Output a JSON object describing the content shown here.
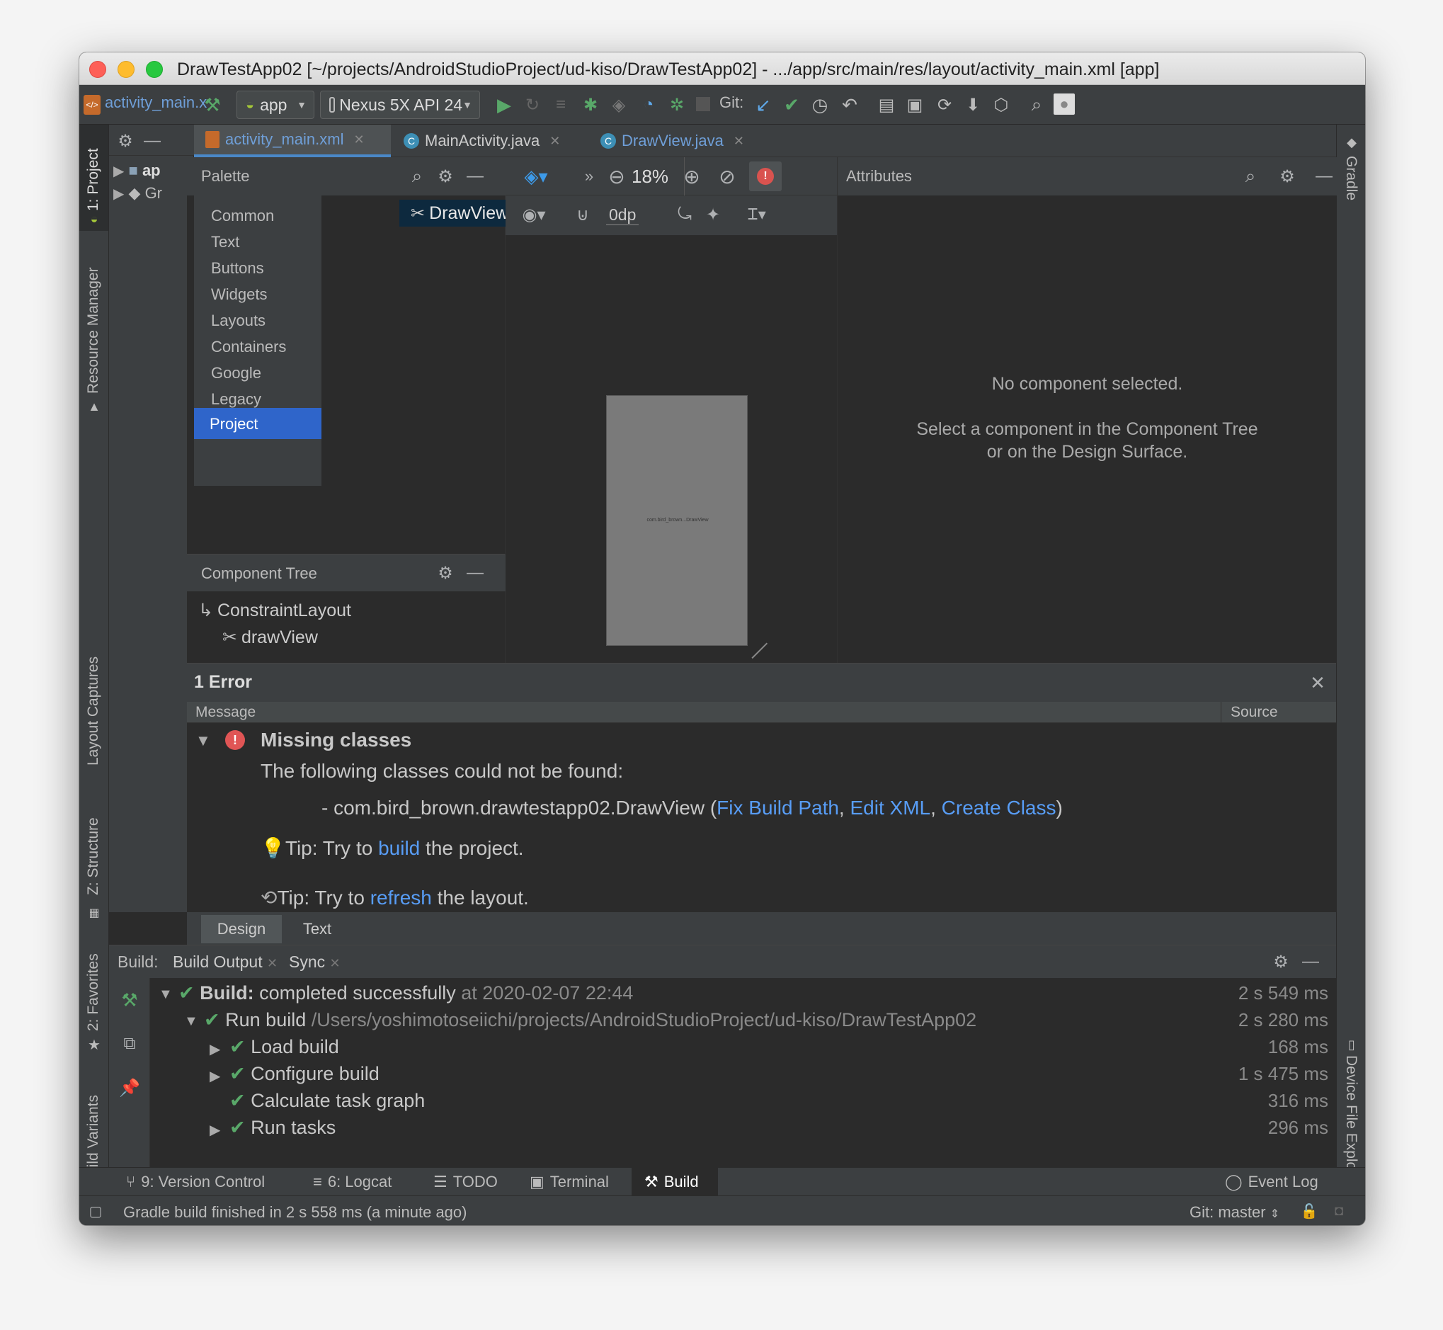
{
  "window": {
    "title": "DrawTestApp02 [~/projects/AndroidStudioProject/ud-kiso/DrawTestApp02] - .../app/src/main/res/layout/activity_main.xml [app]"
  },
  "toolbar": {
    "file_label": "activity_main.x",
    "module": "app",
    "device": "Nexus 5X API 24",
    "git_label": "Git:"
  },
  "left_tool_windows": [
    "1: Project",
    "Resource Manager",
    "Layout Captures",
    "Z: Structure",
    "2: Favorites",
    "Build Variants"
  ],
  "right_tool_windows": [
    "Gradle",
    "Device File Explorer"
  ],
  "project_tree": {
    "items": [
      "ap",
      "Gr"
    ]
  },
  "editor_tabs": [
    {
      "label": "activity_main.xml",
      "active": true
    },
    {
      "label": "MainActivity.java",
      "active": false
    },
    {
      "label": "DrawView.java",
      "active": false
    }
  ],
  "palette": {
    "title": "Palette",
    "categories": [
      "Common",
      "Text",
      "Buttons",
      "Widgets",
      "Layouts",
      "Containers",
      "Google",
      "Legacy",
      "Project"
    ],
    "selected_category": "Project",
    "items": [
      "DrawView"
    ]
  },
  "design_toolbar": {
    "zoom": "18%",
    "margin": "0dp"
  },
  "device_preview": {
    "label": "com.bird_brown...DrawView"
  },
  "attributes": {
    "title": "Attributes",
    "empty_title": "No component selected.",
    "empty_line1": "Select a component in the Component Tree",
    "empty_line2": "or on the Design Surface."
  },
  "component_tree": {
    "title": "Component Tree",
    "root": "ConstraintLayout",
    "child": "drawView"
  },
  "error_panel": {
    "title": "1 Error",
    "col_message": "Message",
    "col_source": "Source",
    "heading": "Missing classes",
    "description": "The following classes could not be found:",
    "class_prefix": "- com.bird_brown.drawtestapp02.DrawView (",
    "link_fix": "Fix Build Path",
    "sep": ",",
    "link_edit": "Edit XML",
    "link_create": "Create Class",
    "class_suffix": ")",
    "tip1_prefix": "Tip: Try to ",
    "tip1_link": "build",
    "tip1_suffix": " the project.",
    "tip2_prefix": "Tip: Try to ",
    "tip2_link": "refresh",
    "tip2_suffix": " the layout."
  },
  "editor_mode_tabs": [
    "Design",
    "Text"
  ],
  "build_panel": {
    "label": "Build:",
    "tabs": [
      "Build Output",
      "Sync"
    ],
    "rows": [
      {
        "bold": "Build:",
        "text": " completed successfully",
        "dim": " at 2020-02-07 22:44",
        "time": "2 s 549 ms"
      },
      {
        "bold": "",
        "text": "Run build ",
        "dim": "/Users/yoshimotoseiichi/projects/AndroidStudioProject/ud-kiso/DrawTestApp02",
        "time": "2 s 280 ms"
      },
      {
        "bold": "",
        "text": "Load build",
        "dim": "",
        "time": "168 ms"
      },
      {
        "bold": "",
        "text": "Configure build",
        "dim": "",
        "time": "1 s 475 ms"
      },
      {
        "bold": "",
        "text": "Calculate task graph",
        "dim": "",
        "time": "316 ms"
      },
      {
        "bold": "",
        "text": "Run tasks",
        "dim": "",
        "time": "296 ms"
      }
    ]
  },
  "bottom_tabs": [
    "9: Version Control",
    "6: Logcat",
    "TODO",
    "Terminal",
    "Build"
  ],
  "event_log": "Event Log",
  "status": {
    "message": "Gradle build finished in 2 s 558 ms (a minute ago)",
    "git": "Git: master"
  },
  "colors": {
    "accent": "#2f65ca",
    "link": "#589df6",
    "success": "#59a869",
    "error": "#e05555",
    "bg_dark": "#2b2b2b",
    "panel": "#3c3f41"
  }
}
